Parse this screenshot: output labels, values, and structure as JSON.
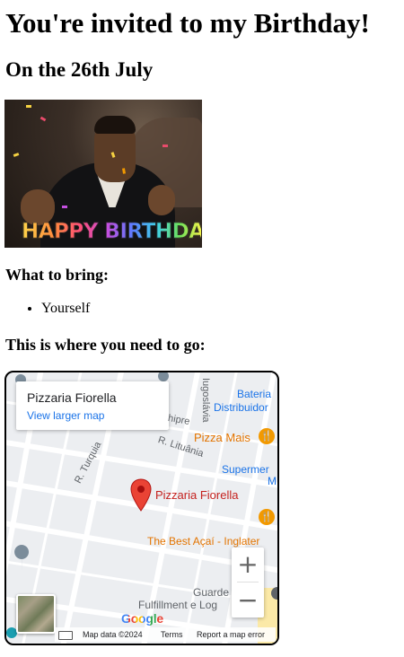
{
  "page": {
    "title": "You're invited to my Birthday!",
    "date": "On the 26th July",
    "gif_caption": "HAPPY BIRTHDAY!",
    "bring_heading": "What to bring:",
    "bring_items": [
      "Yourself"
    ],
    "location_heading": "This is where you need to go:"
  },
  "map": {
    "place_name": "Pizzaria Fiorella",
    "view_larger_link": "View larger map",
    "streets": [
      "Iugoslávia",
      "hipre",
      "R. Lituânia",
      "R. Turquia"
    ],
    "pois": [
      {
        "label": "Bateria",
        "color": "#1a73e8"
      },
      {
        "label": "Distribuidor",
        "color": "#1a73e8"
      },
      {
        "label": "Pizza Mais",
        "color": "#e37400"
      },
      {
        "label": "Supermer",
        "color": "#1a73e8"
      },
      {
        "label": "M",
        "color": "#1a73e8"
      },
      {
        "label": "The Best Açaí - Inglater",
        "color": "#e37400"
      },
      {
        "label": "Guarde",
        "color": "#5f6368"
      },
      {
        "label": "Fulfillment e Log",
        "color": "#5f6368"
      }
    ],
    "pin_label": "Pizzaria Fiorella",
    "zoom_in": "+",
    "zoom_out": "−",
    "logo": "Google",
    "attribution": {
      "map_data": "Map data ©2024",
      "terms": "Terms",
      "report": "Report a map error"
    }
  },
  "colors": {
    "pin": "#ea4335",
    "poi_food": "#f29900",
    "link": "#1a73e8"
  }
}
